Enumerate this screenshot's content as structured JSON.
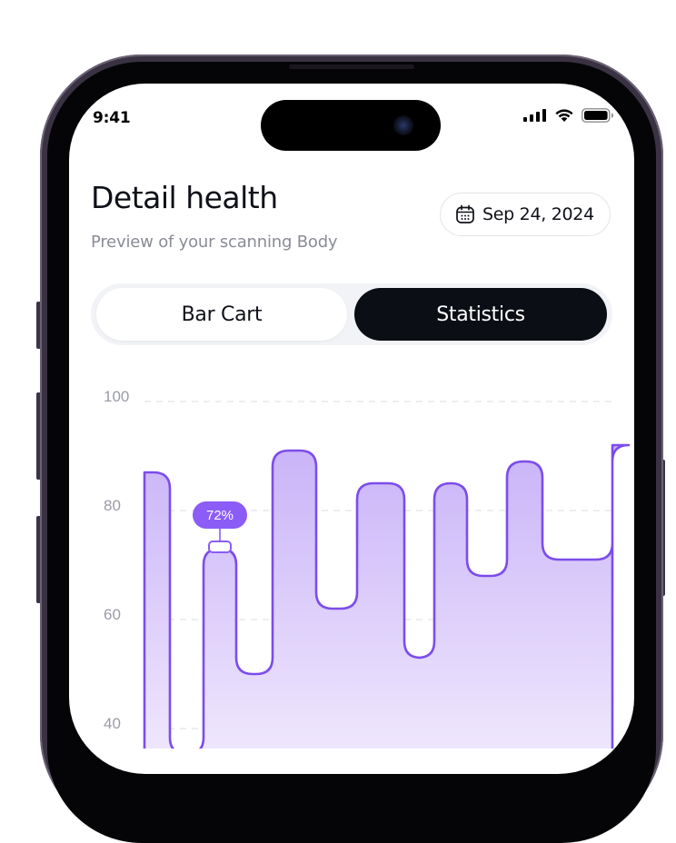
{
  "status_bar": {
    "time": "9:41",
    "icons": [
      "cellular-signal-icon",
      "wifi-icon",
      "battery-icon"
    ]
  },
  "header": {
    "title": "Detail health",
    "subtitle": "Preview of your scanning Body",
    "date": "Sep 24, 2024",
    "date_icon": "calendar-icon"
  },
  "tabs": [
    {
      "label": "Bar Cart",
      "active": false
    },
    {
      "label": "Statistics",
      "active": true
    }
  ],
  "colors": {
    "accent": "#8b5cf6",
    "stroke": "#7c4dea",
    "active_tab": "#0c0e15"
  },
  "chart_data": {
    "type": "area",
    "y_ticks": [
      "100",
      "80",
      "60",
      "40"
    ],
    "ylim": [
      33,
      100
    ],
    "grid": true,
    "values": [
      86,
      0,
      72,
      49,
      90,
      61,
      84,
      52,
      84,
      67,
      88,
      70,
      91
    ],
    "highlight": {
      "index": 2,
      "label": "72%"
    }
  }
}
